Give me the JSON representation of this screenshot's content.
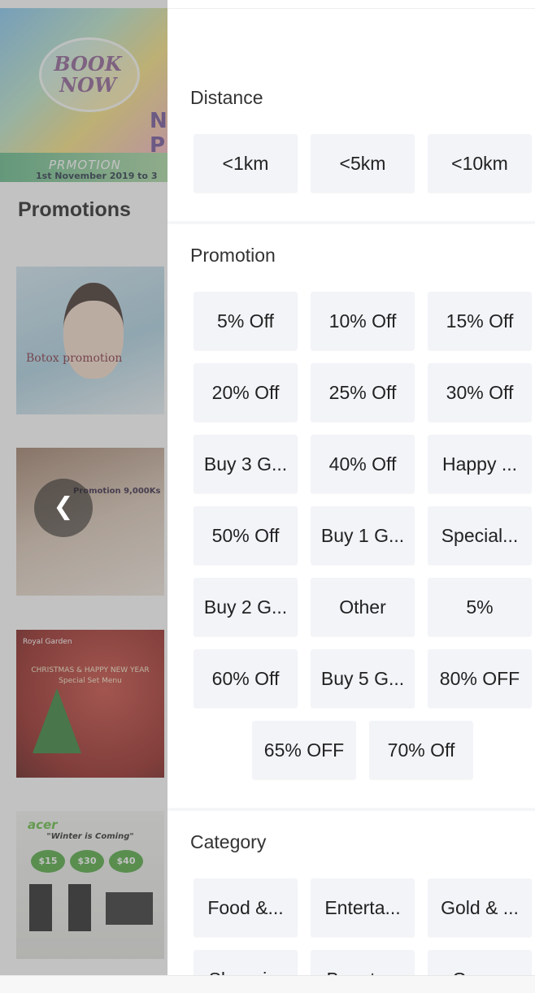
{
  "background": {
    "banner": {
      "cta": "BOOK NOW",
      "side_text": "N P",
      "ribbon": "PRMOTION",
      "date": "1st November 2019 to 3"
    },
    "heading": "Promotions",
    "cards": [
      {
        "text": "Botox promotion"
      },
      {
        "text": "Promotion 9,000Ks"
      },
      {
        "title": "CHRISTMAS & HAPPY NEW YEAR Special Set Menu",
        "brand": "Royal Garden"
      },
      {
        "brand": "acer",
        "title": "\"Winter is Coming\"",
        "prices": [
          "$15",
          "$30",
          "$40"
        ]
      }
    ],
    "nav_icon": "chevron-left-icon"
  },
  "filters": {
    "distance": {
      "title": "Distance",
      "options": [
        "<1km",
        "<5km",
        "<10km"
      ]
    },
    "promotion": {
      "title": "Promotion",
      "options": [
        "5% Off",
        "10% Off",
        "15% Off",
        "20% Off",
        "25% Off",
        "30% Off",
        "Buy 3 G...",
        "40% Off",
        "Happy ...",
        "50% Off",
        "Buy 1 G...",
        "Special...",
        "Buy 2 G...",
        "Other",
        "5%",
        "60% Off",
        "Buy 5 G...",
        "80% OFF",
        "65% OFF",
        "70% Off"
      ]
    },
    "category": {
      "title": "Category",
      "options": [
        "Food &...",
        "Enterta...",
        "Gold & ...",
        "Shoppi...",
        "Beauty...",
        "Gym..."
      ]
    }
  }
}
